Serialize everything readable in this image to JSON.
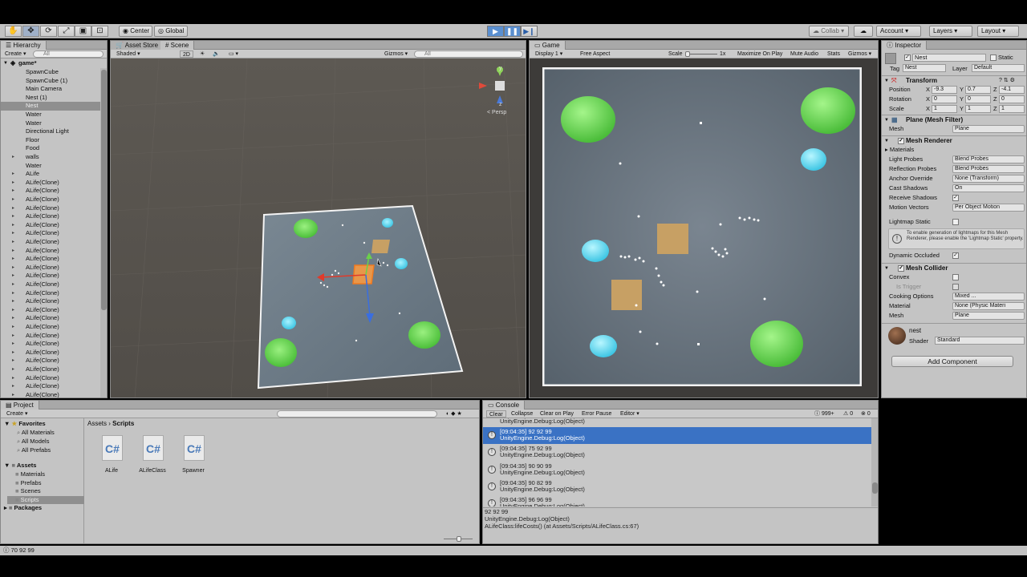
{
  "toolbar": {
    "tools": [
      "hand-tool-icon",
      "move-tool-icon",
      "rotate-tool-icon",
      "scale-tool-icon",
      "rect-tool-icon",
      "transform-tool-icon"
    ],
    "pivot": "Center",
    "space": "Global",
    "collab": "Collab",
    "account": "Account",
    "layers": "Layers",
    "layout": "Layout"
  },
  "hierarchy": {
    "tab": "Hierarchy",
    "create": "Create",
    "search_placeholder": "All",
    "scene_name": "game*",
    "items": [
      {
        "label": "SpawnCube",
        "arrow": false,
        "selected": false
      },
      {
        "label": "SpawnCube (1)",
        "arrow": false,
        "selected": false
      },
      {
        "label": "Main Camera",
        "arrow": false,
        "selected": false
      },
      {
        "label": "Nest (1)",
        "arrow": false,
        "selected": false
      },
      {
        "label": "Nest",
        "arrow": false,
        "selected": true
      },
      {
        "label": "Water",
        "arrow": false,
        "selected": false
      },
      {
        "label": "Water",
        "arrow": false,
        "selected": false
      },
      {
        "label": "Directional Light",
        "arrow": false,
        "selected": false
      },
      {
        "label": "Floor",
        "arrow": false,
        "selected": false
      },
      {
        "label": "Food",
        "arrow": false,
        "selected": false
      },
      {
        "label": "walls",
        "arrow": true,
        "selected": false
      },
      {
        "label": "Water",
        "arrow": false,
        "selected": false
      },
      {
        "label": "ALife",
        "arrow": true,
        "selected": false
      },
      {
        "label": "ALife(Clone)",
        "arrow": true,
        "selected": false
      },
      {
        "label": "ALife(Clone)",
        "arrow": true,
        "selected": false
      },
      {
        "label": "ALife(Clone)",
        "arrow": true,
        "selected": false
      },
      {
        "label": "ALife(Clone)",
        "arrow": true,
        "selected": false
      },
      {
        "label": "ALife(Clone)",
        "arrow": true,
        "selected": false
      },
      {
        "label": "ALife(Clone)",
        "arrow": true,
        "selected": false
      },
      {
        "label": "ALife(Clone)",
        "arrow": true,
        "selected": false
      },
      {
        "label": "ALife(Clone)",
        "arrow": true,
        "selected": false
      },
      {
        "label": "ALife(Clone)",
        "arrow": true,
        "selected": false
      },
      {
        "label": "ALife(Clone)",
        "arrow": true,
        "selected": false
      },
      {
        "label": "ALife(Clone)",
        "arrow": true,
        "selected": false
      },
      {
        "label": "ALife(Clone)",
        "arrow": true,
        "selected": false
      },
      {
        "label": "ALife(Clone)",
        "arrow": true,
        "selected": false
      },
      {
        "label": "ALife(Clone)",
        "arrow": true,
        "selected": false
      },
      {
        "label": "ALife(Clone)",
        "arrow": true,
        "selected": false
      },
      {
        "label": "ALife(Clone)",
        "arrow": true,
        "selected": false
      },
      {
        "label": "ALife(Clone)",
        "arrow": true,
        "selected": false
      },
      {
        "label": "ALife(Clone)",
        "arrow": true,
        "selected": false
      },
      {
        "label": "ALife(Clone)",
        "arrow": true,
        "selected": false
      },
      {
        "label": "ALife(Clone)",
        "arrow": true,
        "selected": false
      },
      {
        "label": "ALife(Clone)",
        "arrow": true,
        "selected": false
      },
      {
        "label": "ALife(Clone)",
        "arrow": true,
        "selected": false
      },
      {
        "label": "ALife(Clone)",
        "arrow": true,
        "selected": false
      },
      {
        "label": "ALife(Clone)",
        "arrow": true,
        "selected": false
      },
      {
        "label": "ALife(Clone)",
        "arrow": true,
        "selected": false
      },
      {
        "label": "ALife(Clone)",
        "arrow": true,
        "selected": false
      },
      {
        "label": "ALife(Clone)",
        "arrow": true,
        "selected": false
      },
      {
        "label": "ALife(Clone)",
        "arrow": true,
        "selected": false
      }
    ]
  },
  "scene": {
    "tab_asset_store": "Asset Store",
    "tab_scene": "Scene",
    "shading": "Shaded",
    "mode_2d": "2D",
    "gizmos": "Gizmos",
    "search_placeholder": "All",
    "persp": "< Persp",
    "axis_y": "y",
    "axis_z": "z"
  },
  "game": {
    "tab": "Game",
    "display": "Display 1",
    "aspect": "Free Aspect",
    "scale_label": "Scale",
    "scale_value": "1x",
    "maximize": "Maximize On Play",
    "mute": "Mute Audio",
    "stats": "Stats",
    "gizmos": "Gizmos"
  },
  "inspector": {
    "tab": "Inspector",
    "name": "Nest",
    "static": "Static",
    "tag_label": "Tag",
    "tag_value": "Nest",
    "layer_label": "Layer",
    "layer_value": "Default",
    "transform_title": "Transform",
    "position_label": "Position",
    "rotation_label": "Rotation",
    "scale_label": "Scale",
    "position": [
      "-9.3",
      "0.7",
      "-4.1"
    ],
    "rotation": [
      "0",
      "0",
      "0"
    ],
    "scale": [
      "1",
      "1",
      "1"
    ],
    "axis_x": "X",
    "axis_y": "Y",
    "axis_z": "Z",
    "mesh_filter_title": "Plane (Mesh Filter)",
    "mesh_label": "Mesh",
    "mesh_value": "Plane",
    "mesh_renderer_title": "Mesh Renderer",
    "materials_label": "Materials",
    "light_probes_label": "Light Probes",
    "light_probes_value": "Blend Probes",
    "reflection_probes_label": "Reflection Probes",
    "reflection_probes_value": "Blend Probes",
    "anchor_override_label": "Anchor Override",
    "anchor_override_value": "None (Transform)",
    "cast_shadows_label": "Cast Shadows",
    "cast_shadows_value": "On",
    "receive_shadows_label": "Receive Shadows",
    "motion_vectors_label": "Motion Vectors",
    "motion_vectors_value": "Per Object Motion",
    "lightmap_static_label": "Lightmap Static",
    "lightmap_info": "To enable generation of lightmaps for this Mesh Renderer, please enable the 'Lightmap Static' property.",
    "dynamic_occluded_label": "Dynamic Occluded",
    "mesh_collider_title": "Mesh Collider",
    "convex_label": "Convex",
    "is_trigger_label": "Is Trigger",
    "cooking_options_label": "Cooking Options",
    "cooking_options_value": "Mixed ...",
    "material_label": "Material",
    "material_value": "None (Physic Materi",
    "collider_mesh_label": "Mesh",
    "collider_mesh_value": "Plane",
    "material_name": "nest",
    "shader_label": "Shader",
    "shader_value": "Standard",
    "add_component": "Add Component"
  },
  "project": {
    "tab": "Project",
    "create": "Create",
    "favorites": "Favorites",
    "favorite_items": [
      "All Materials",
      "All Models",
      "All Prefabs"
    ],
    "assets": "Assets",
    "asset_folders": [
      "Materials",
      "Prefabs",
      "Scenes",
      "Scripts"
    ],
    "packages": "Packages",
    "breadcrumb_root": "Assets",
    "breadcrumb_sep": "›",
    "breadcrumb_current": "Scripts",
    "files": [
      {
        "name": "ALife",
        "type": "C#"
      },
      {
        "name": "ALifeClass",
        "type": "C#"
      },
      {
        "name": "Spawner",
        "type": "C#"
      }
    ]
  },
  "console": {
    "tab": "Console",
    "clear": "Clear",
    "collapse": "Collapse",
    "clear_on_play": "Clear on Play",
    "error_pause": "Error Pause",
    "editor": "Editor",
    "log_count": "999+",
    "warn_count": "0",
    "error_count": "0",
    "top_partial": "UnityEngine.Debug:Log(Object)",
    "entries": [
      {
        "line1": "[09:04:35] 92 92 99",
        "line2": "UnityEngine.Debug:Log(Object)",
        "selected": true
      },
      {
        "line1": "[09:04:35] 75 92 99",
        "line2": "UnityEngine.Debug:Log(Object)",
        "selected": false
      },
      {
        "line1": "[09:04:35] 90 90 99",
        "line2": "UnityEngine.Debug:Log(Object)",
        "selected": false
      },
      {
        "line1": "[09:04:35] 90 82 99",
        "line2": "UnityEngine.Debug:Log(Object)",
        "selected": false
      },
      {
        "line1": "[09:04:35] 96 96 99",
        "line2": "UnityEngine.Debug:Log(Object)",
        "selected": false
      }
    ],
    "detail": [
      "92 92 99",
      "UnityEngine.Debug:Log(Object)",
      "ALifeClass:lifeCosts() (at Assets/Scripts/ALifeClass.cs:67)"
    ]
  },
  "status": {
    "text": "70 92 99"
  },
  "colors": {
    "nest_green": "#7fe06a",
    "water_cyan": "#6fdcf0",
    "food_tan": "#c7a064",
    "selection_blue": "#3a72c4",
    "play_active": "#5a8fd0"
  }
}
